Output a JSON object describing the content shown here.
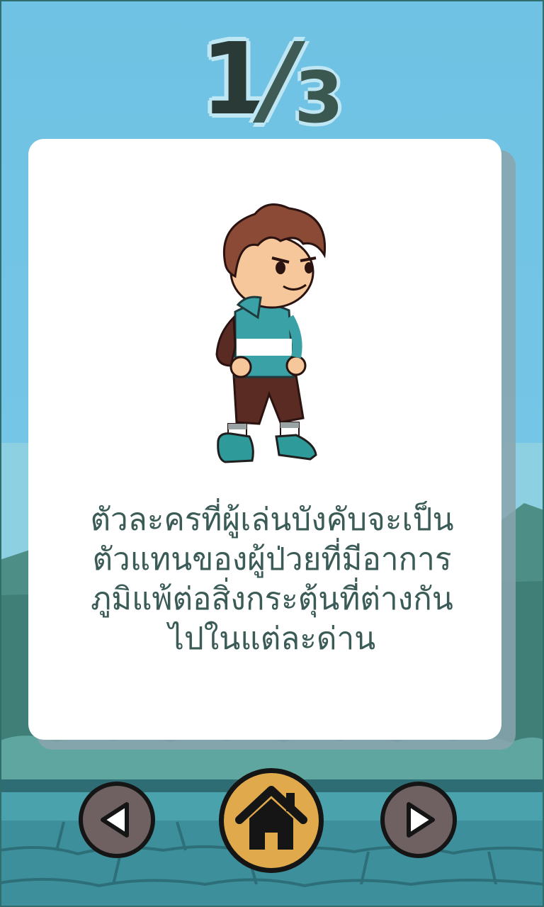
{
  "page_counter": {
    "current": "1",
    "separator": "/",
    "total": "3"
  },
  "card": {
    "description": "ตัวละครที่ผู้เล่นบังคับจะเป็น\nตัวแทนของผู้ป่วยที่มีอาการ\nภูมิแพ้ต่อสิ่งกระตุ้นที่ต่างกัน\nไปในแต่ละด่าน",
    "character_image": "player-character-boy"
  },
  "nav": {
    "prev_icon": "triangle-left-icon",
    "home_icon": "home-icon",
    "next_icon": "triangle-right-icon"
  },
  "colors": {
    "sky": "#6fc2e3",
    "card": "#ffffff",
    "text": "#3b5b57",
    "nav_button": "#6f6161",
    "home_button": "#e0a94c"
  }
}
